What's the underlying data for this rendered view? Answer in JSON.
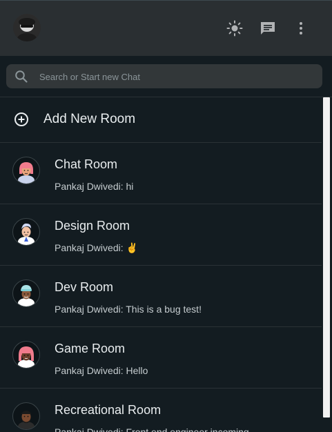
{
  "header": {
    "avatar_alt": "Profile picture",
    "icons": [
      "brightness-icon",
      "new-chat-icon",
      "more-vert-icon"
    ]
  },
  "search": {
    "placeholder": "Search or Start new Chat",
    "value": ""
  },
  "add_room": {
    "label": "Add New Room"
  },
  "rooms": [
    {
      "name": "Chat Room",
      "last_message": "Pankaj Dwivedi: hi"
    },
    {
      "name": "Design Room",
      "last_message": "Pankaj Dwivedi: ✌"
    },
    {
      "name": "Dev Room",
      "last_message": "Pankaj Dwivedi: This is a bug test!"
    },
    {
      "name": "Game Room",
      "last_message": "Pankaj Dwivedi: Hello"
    },
    {
      "name": "Recreational Room",
      "last_message": "Pankaj Dwivedi: Front end engineer incoming"
    }
  ],
  "colors": {
    "header_bg": "#2a2f32",
    "list_bg": "#131c21",
    "search_bg": "#323739",
    "icon": "#b1b3b5",
    "text_primary": "#e9edef",
    "text_secondary": "#c5cccf"
  }
}
